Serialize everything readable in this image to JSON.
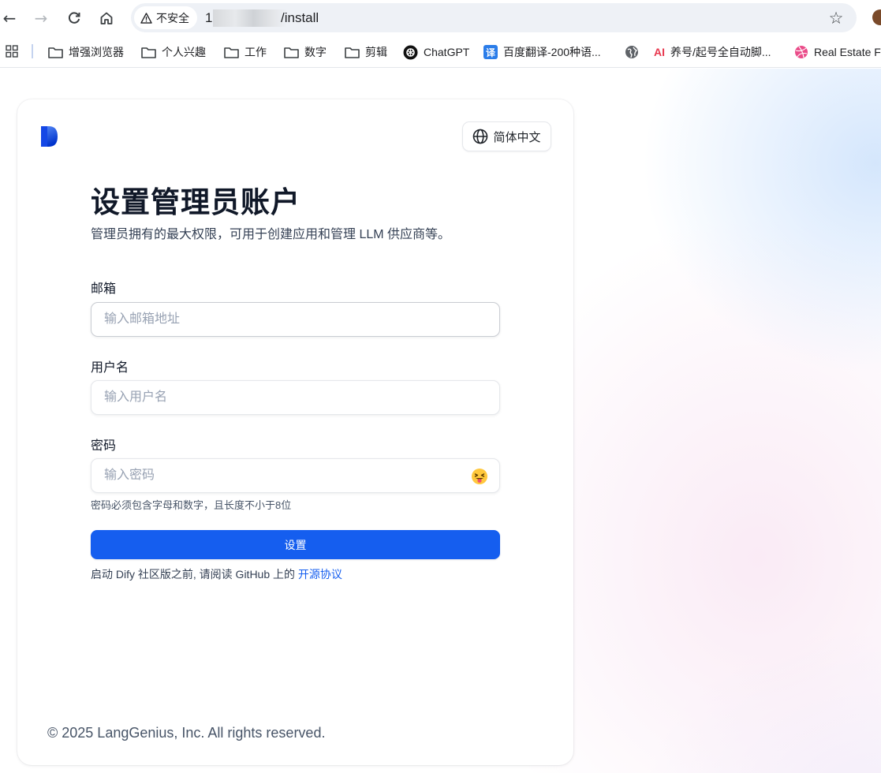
{
  "browser": {
    "back_label": "←",
    "forward_label": "→",
    "reload_label": "C",
    "home_label": "⌂",
    "security_text": "不安全",
    "url_host_visible": "1",
    "url_path": "/install",
    "star_label": "☆"
  },
  "bookmarks": [
    {
      "label": "增强浏览器",
      "icon": "folder-icon"
    },
    {
      "label": "个人兴趣",
      "icon": "folder-icon"
    },
    {
      "label": "工作",
      "icon": "folder-icon"
    },
    {
      "label": "数字",
      "icon": "folder-icon"
    },
    {
      "label": "剪辑",
      "icon": "folder-icon"
    },
    {
      "label": "ChatGPT",
      "icon": "chatgpt-icon"
    },
    {
      "label": "百度翻译-200种语...",
      "icon": "baidu-translate-icon",
      "badge": "译"
    },
    {
      "label": "",
      "icon": "globe-icon"
    },
    {
      "label": "养号/起号全自动脚...",
      "icon": "ai-icon",
      "badge": "AI"
    },
    {
      "label": "Real Estate F",
      "icon": "dribbble-icon"
    }
  ],
  "page": {
    "language_label": "简体中文",
    "title": "设置管理员账户",
    "subtitle": "管理员拥有的最大权限，可用于创建应用和管理 LLM 供应商等。",
    "fields": {
      "email": {
        "label": "邮箱",
        "placeholder": "输入邮箱地址",
        "value": ""
      },
      "username": {
        "label": "用户名",
        "placeholder": "输入用户名",
        "value": ""
      },
      "password": {
        "label": "密码",
        "placeholder": "输入密码",
        "value": "",
        "toggle_icon": "😝"
      }
    },
    "password_hint": "密码必须包含字母和数字，且长度不小于8位",
    "submit_label": "设置",
    "agreement_text": "启动 Dify 社区版之前, 请阅读 GitHub 上的 ",
    "agreement_link": "开源协议",
    "footer": "© 2025 LangGenius, Inc. All rights reserved."
  },
  "colors": {
    "primary": "#155eef",
    "card_bg": "#ffffff",
    "text_primary": "#101828",
    "text_secondary": "#475467"
  }
}
